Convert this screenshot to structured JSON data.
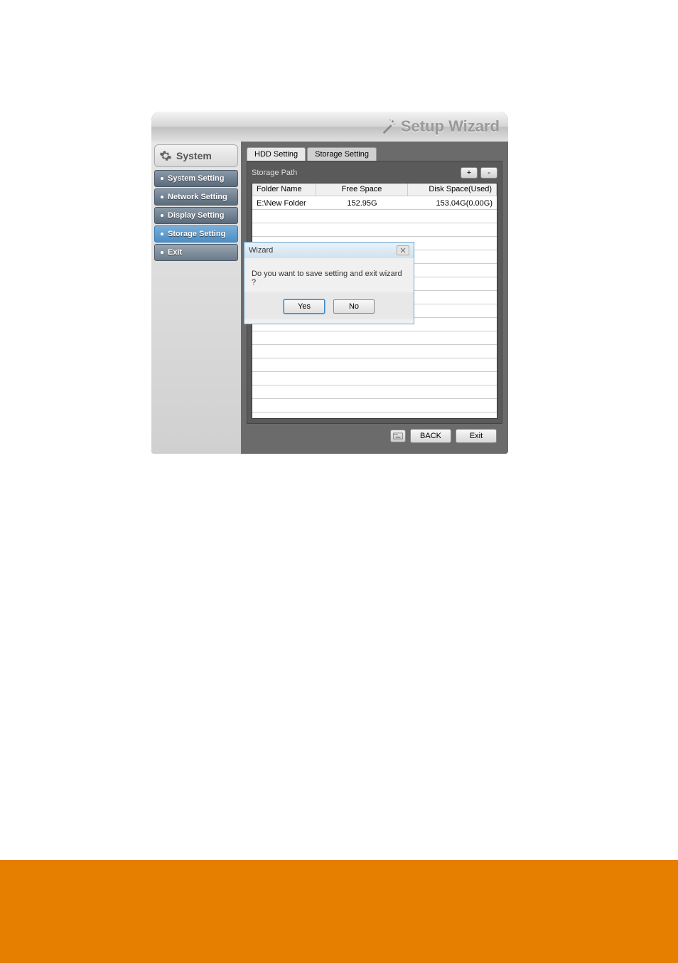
{
  "window": {
    "title": "Setup Wizard"
  },
  "sidebar": {
    "header": "System",
    "items": [
      {
        "label": "System Setting"
      },
      {
        "label": "Network Setting"
      },
      {
        "label": "Display Setting"
      },
      {
        "label": "Storage Setting"
      },
      {
        "label": "Exit"
      }
    ]
  },
  "tabs": [
    {
      "label": "HDD Setting"
    },
    {
      "label": "Storage Setting"
    }
  ],
  "storage": {
    "path_label": "Storage Path",
    "add_label": "+",
    "remove_label": "-",
    "columns": [
      "Folder Name",
      "Free Space",
      "Disk Space(Used)"
    ],
    "rows": [
      {
        "folder": "E:\\New Folder",
        "free": "152.95G",
        "disk": "153.04G(0.00G)"
      }
    ]
  },
  "footer": {
    "back": "BACK",
    "exit": "Exit"
  },
  "modal": {
    "title": "Wizard",
    "message": "Do you want to save setting and exit wizard ?",
    "yes": "Yes",
    "no": "No"
  }
}
